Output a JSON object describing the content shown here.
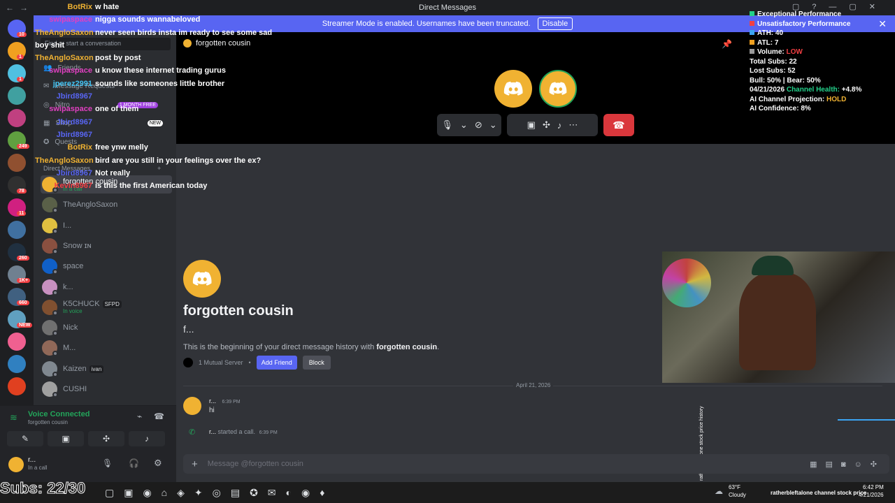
{
  "titlebar": {
    "title": "Direct Messages"
  },
  "banner": {
    "text": "Streamer Mode is enabled. Usernames have been truncated.",
    "button": "Disable"
  },
  "dm_panel": {
    "search_placeholder": "Find or start a conversation",
    "nav": [
      {
        "label": "Friends"
      },
      {
        "label": "Message Requests"
      },
      {
        "label": "Nitro",
        "badge": "1 MONTH FREE"
      },
      {
        "label": "Shop",
        "badge": "NEW"
      },
      {
        "label": "Quests"
      }
    ],
    "section": "Direct Messages",
    "conversations": [
      {
        "name": "forgotten cousin",
        "status": "In a call",
        "color": "#f0b232"
      },
      {
        "name": "TheAngloSaxon",
        "status": "",
        "color": "#5a6048"
      },
      {
        "name": "I...",
        "status": "",
        "color": "#e0c040"
      },
      {
        "name": "Snow ɪɴ",
        "status": "",
        "color": "#8a5040"
      },
      {
        "name": "space",
        "status": "",
        "color": "#1060c8"
      },
      {
        "name": "k...",
        "status": "",
        "color": "#c890c0"
      },
      {
        "name": "K5CHUCK",
        "status": "In voice",
        "tag": "SFPD",
        "color": "#805030"
      },
      {
        "name": "Nick",
        "status": "",
        "color": "#707070"
      },
      {
        "name": "M...",
        "status": "",
        "color": "#906858"
      },
      {
        "name": "Kaizen",
        "status": "",
        "tag": "ivan",
        "color": "#808890"
      },
      {
        "name": "CUSHI",
        "status": "",
        "color": "#a0a0a0"
      }
    ]
  },
  "voice": {
    "title": "Voice Connected",
    "channel": "forgotten cousin"
  },
  "user": {
    "name": "r...",
    "status": "In a call"
  },
  "server_badges": [
    "10",
    "1",
    "1",
    "249",
    "78",
    "11",
    "260",
    "1K+",
    "660",
    "NEW"
  ],
  "chat_header": {
    "name": "forgotten cousin"
  },
  "stats": {
    "lines": [
      {
        "label": "Exceptional Performance",
        "color": "#23d18b"
      },
      {
        "label": "Unsatisfactory Performance",
        "color": "#f23f43"
      }
    ],
    "ath_label": "ATH:",
    "ath": "40",
    "ath_color": "#3ba4f2",
    "atl_label": "ATL:",
    "atl": "7",
    "atl_color": "#f0a020",
    "volume_label": "Volume:",
    "volume": "LOW",
    "total_subs": "Total Subs: 22",
    "lost_subs": "Lost Subs: 52",
    "bull_bear": "Bull: 50% | Bear: 50%",
    "date": "04/21/2026",
    "health_label": "Channel Health:",
    "health": "+4.8%",
    "projection_label": "AI Channel Projection:",
    "projection": "HOLD",
    "confidence": "AI Confidence: 8%"
  },
  "chat_overlay": [
    {
      "user": "BotRix",
      "msg": "w hate",
      "color": "#f0b232"
    },
    {
      "user": "swipaspace",
      "msg": "nigga sounds wannabeloved",
      "color": "#e040c0"
    },
    {
      "user": "TheAngloSaxon",
      "msg": "never seen birds insta im ready to see some sad boy shit",
      "color": "#f0b232"
    },
    {
      "user": "TheAngloSaxon",
      "msg": "post by post",
      "color": "#f0b232"
    },
    {
      "user": "swipaspace",
      "msg": "u know these internet trading gurus",
      "color": "#e040c0"
    },
    {
      "user": "jperez2991",
      "msg": "sounds like someones little brother",
      "color": "#40c0f0"
    },
    {
      "user": "Jbird8967",
      "msg": "",
      "color": "#5865f2"
    },
    {
      "user": "swipaspace",
      "msg": "one of them",
      "color": "#e040c0"
    },
    {
      "user": "Jbird8967",
      "msg": "",
      "color": "#5865f2"
    },
    {
      "user": "Jbird8967",
      "msg": "",
      "color": "#5865f2"
    },
    {
      "user": "BotRix",
      "msg": "free ynw melly",
      "color": "#f0b232"
    },
    {
      "user": "TheAngloSaxon",
      "msg": "bird are you still in your feelings over the ex?",
      "color": "#f0b232"
    },
    {
      "user": "Jbird8967",
      "msg": "Not really",
      "color": "#5865f2"
    },
    {
      "user": "Kevin8967",
      "msg": "is this the first American today",
      "color": "#f23f43"
    }
  ],
  "intro": {
    "name": "forgotten cousin",
    "short": "f...",
    "desc_prefix": "This is the beginning of your direct message history with ",
    "desc_name": "forgotten cousin",
    "desc_suffix": ".",
    "mutual": "1 Mutual Server",
    "add": "Add Friend",
    "block": "Block"
  },
  "date_sep": "April 21, 2026",
  "messages": [
    {
      "author": "r...",
      "time": "6:39 PM",
      "text": "hi"
    },
    {
      "author": "r...",
      "text": "started a call.",
      "time": "6:39 PM"
    }
  ],
  "composer": {
    "placeholder": "Message @forgotten cousin"
  },
  "side_label": "ratherbleftalone stock price history",
  "taskbar": {
    "subs": "Subs: 22/30",
    "weather_temp": "63°F",
    "weather_desc": "Cloudy",
    "ticker": "ratherbleftalone channel stock price",
    "time": "6:42 PM",
    "date": "4/21/2026"
  }
}
